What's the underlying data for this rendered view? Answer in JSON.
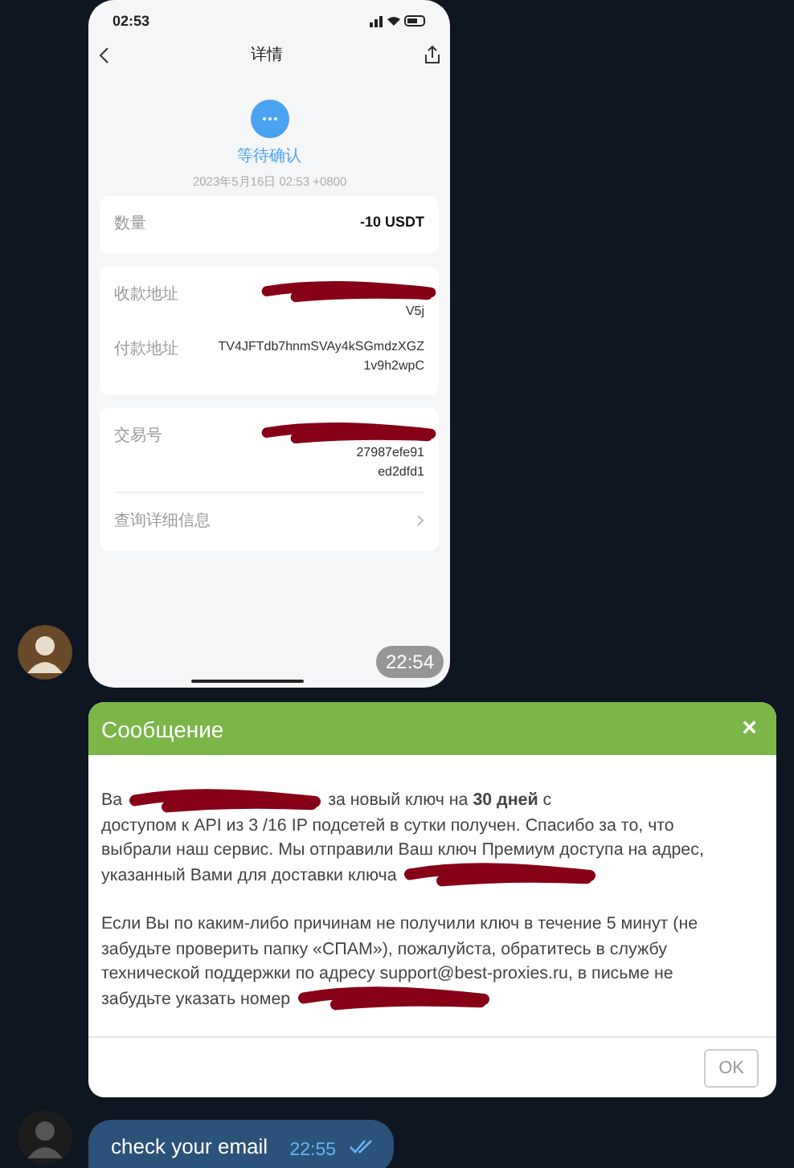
{
  "phone_screenshot": {
    "status_time": "02:53",
    "title": "详情",
    "status": "等待确认",
    "date": "2023年5月16日 02:53 +0800",
    "cards": [
      {
        "rows": [
          {
            "label": "数量",
            "lines": [
              "-10 USDT"
            ],
            "bold": true,
            "redacted": false
          }
        ]
      },
      {
        "rows": [
          {
            "label": "收款地址",
            "lines": [
              "V5j"
            ],
            "bold": false,
            "redacted": true
          },
          {
            "label": "付款地址",
            "lines": [
              "TV4JFTdb7hnmSVAy4kSGmdzXGZ",
              "1v9h2wpC"
            ],
            "bold": false,
            "redacted": false
          }
        ]
      },
      {
        "rows": [
          {
            "label": "交易号",
            "lines": [
              "27987efe91",
              "ed2dfd1"
            ],
            "bold": false,
            "redacted": true
          }
        ],
        "link": "查询详细信息"
      }
    ],
    "time": "22:54"
  },
  "dialog": {
    "title": "Сообщение",
    "close": "×",
    "paragraphs": [
      [
        [
          {
            "kind": "text",
            "text": "Ва"
          },
          {
            "kind": "redacted"
          },
          {
            "kind": "text",
            "text": "за новый ключ на **30 дней** с"
          }
        ],
        [
          {
            "kind": "text",
            "text": "доступом к API из 3 /16 IP подсетей в сутки получен. Спасибо за то, что"
          }
        ],
        [
          {
            "kind": "text",
            "text": "выбрали наш сервис. Мы отправили Ваш ключ Премиум доступа на адрес,"
          }
        ],
        [
          {
            "kind": "text",
            "text": "указанный Вами для доставки ключа"
          },
          {
            "kind": "redacted"
          }
        ]
      ],
      [
        [
          {
            "kind": "text",
            "text": "Если Вы по каким-либо причинам не получили ключ в течение 5 минут (не"
          }
        ],
        [
          {
            "kind": "text",
            "text": "забудьте проверить папку «СПАМ»), пожалуйста, обратитесь в службу"
          }
        ],
        [
          {
            "kind": "text",
            "text": "технической поддержки по адресу support@best-proxies.ru, в письме не"
          }
        ],
        [
          {
            "kind": "text",
            "text": "забудьте указать номер"
          },
          {
            "kind": "redacted"
          }
        ]
      ]
    ],
    "button": "OK"
  },
  "message": {
    "text": "check your email",
    "time": "22:55",
    "read": true
  }
}
